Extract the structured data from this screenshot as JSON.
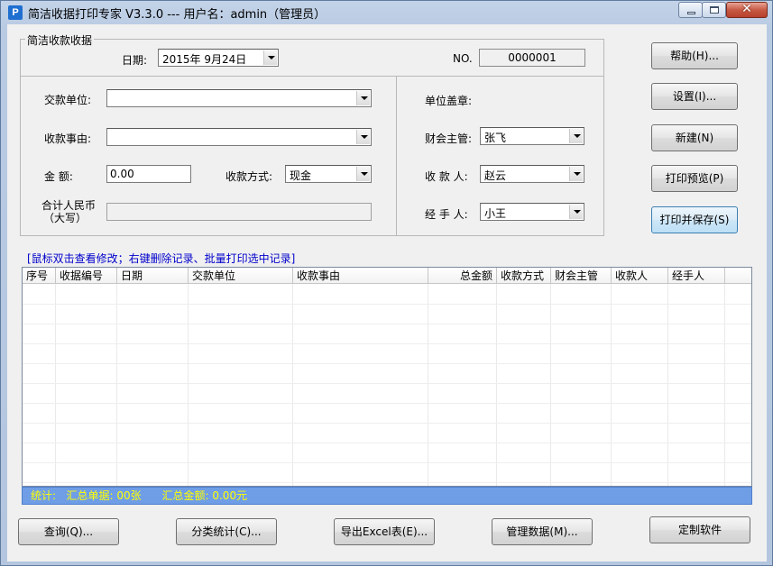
{
  "window": {
    "title": "简洁收据打印专家 V3.3.0 --- 用户名：admin（管理员）",
    "close_glyph": "✕"
  },
  "form": {
    "group_title": "简洁收款收据",
    "date_label": "日期:",
    "date_value": "2015年  9月24日",
    "no_label": "NO.",
    "no_value": "0000001",
    "payer_label": "交款单位:",
    "payer_value": "",
    "reason_label": "收款事由:",
    "reason_value": "",
    "amount_label": "金    额:",
    "amount_value": "0.00",
    "method_label": "收款方式:",
    "method_value": "现金",
    "total_rmb_label_line1": "合计人民币",
    "total_rmb_label_line2": "（大写）",
    "total_rmb_value": "",
    "seal_label": "单位盖章:",
    "finance_label": "财会主管:",
    "finance_value": "张飞",
    "payee_label": "收 款 人:",
    "payee_value": "赵云",
    "handler_label": "经 手 人:",
    "handler_value": "小王"
  },
  "side_buttons": {
    "help": "帮助(H)...",
    "settings": "设置(I)...",
    "new": "新建(N)",
    "print_preview": "打印预览(P)",
    "print_save": "打印并保存(S)"
  },
  "hint": "[鼠标双击查看修改；右键删除记录、批量打印选中记录]",
  "table": {
    "columns": [
      "序号",
      "收据编号",
      "日期",
      "交款单位",
      "收款事由",
      "总金额",
      "收款方式",
      "财会主管",
      "收款人",
      "经手人"
    ],
    "rows": []
  },
  "status": {
    "text": "统计:   汇总单据: 00张      汇总金额: 0.00元"
  },
  "bottom_buttons": {
    "query": "查询(Q)...",
    "category_stats": "分类统计(C)...",
    "export_excel": "导出Excel表(E)...",
    "manage_data": "管理数据(M)...",
    "custom_software": "定制软件"
  }
}
